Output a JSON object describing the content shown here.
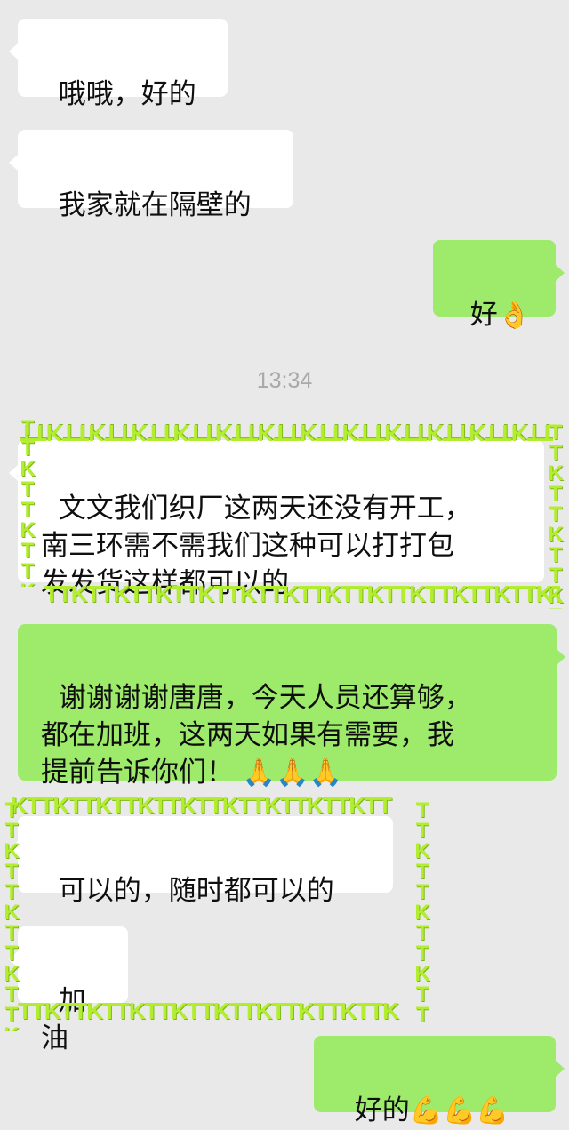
{
  "messages": [
    {
      "side": "in",
      "text": "哦哦，好的"
    },
    {
      "side": "in",
      "text": "我家就在隔壁的"
    },
    {
      "side": "out",
      "text": "好",
      "emoji": "👌"
    },
    {
      "side": "in",
      "text": "文文我们织厂这两天还没有开工，\n南三环需不需我们这种可以打打包\n发发货这样都可以的"
    },
    {
      "side": "out",
      "text": "谢谢谢谢唐唐，今天人员还算够，\n都在加班，这两天如果有需要，我\n提前告诉你们！",
      "emoji": "🙏🙏🙏"
    },
    {
      "side": "in",
      "text": "可以的，随时都可以的"
    },
    {
      "side": "in",
      "text": "加油"
    },
    {
      "side": "out",
      "text": "好的",
      "emoji": "💪💪💪"
    }
  ],
  "timestamp": "13:34",
  "watermark": {
    "pattern": "TTK",
    "color": "#b2ee2f"
  }
}
